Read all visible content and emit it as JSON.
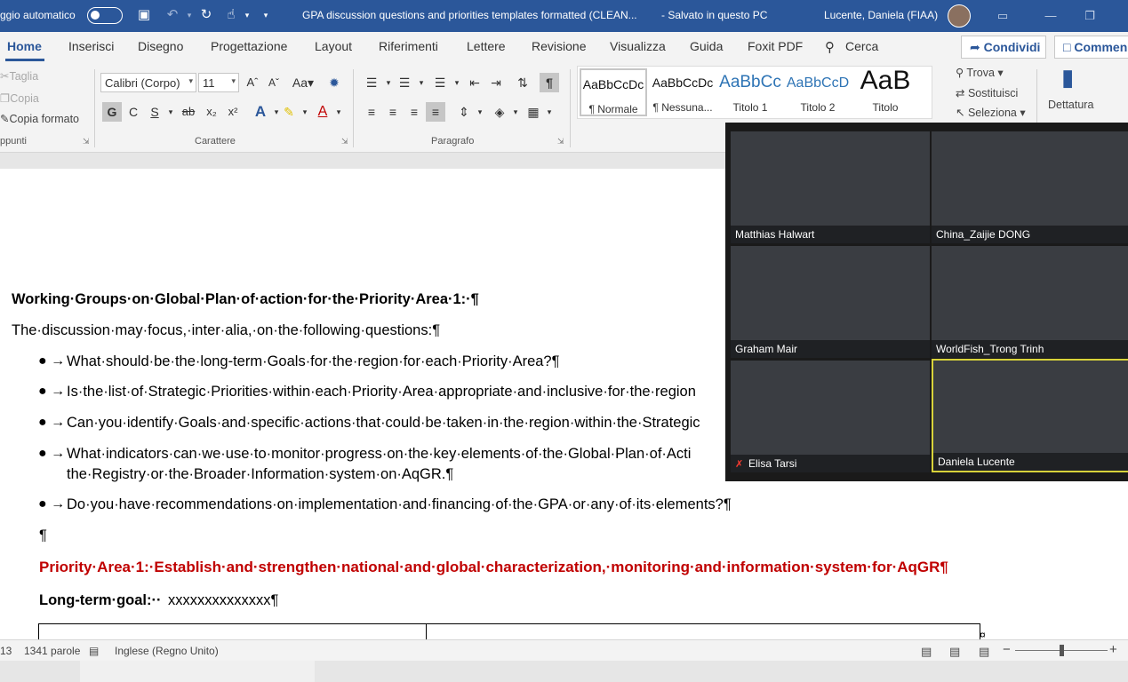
{
  "titlebar": {
    "autosave_label": "ggio automatico",
    "document_title": "GPA discussion questions and priorities templates formatted (CLEAN...",
    "save_status": "-  Salvato in questo PC",
    "user_name": "Lucente, Daniela (FIAA)"
  },
  "tabs": [
    {
      "label": "Home"
    },
    {
      "label": "Inserisci"
    },
    {
      "label": "Disegno"
    },
    {
      "label": "Progettazione"
    },
    {
      "label": "Layout"
    },
    {
      "label": "Riferimenti"
    },
    {
      "label": "Lettere"
    },
    {
      "label": "Revisione"
    },
    {
      "label": "Visualizza"
    },
    {
      "label": "Guida"
    },
    {
      "label": "Foxit PDF"
    },
    {
      "label": "Cerca"
    }
  ],
  "share_label": "Condividi",
  "comments_label": "Commen",
  "ribbon": {
    "clipboard": {
      "cut": "Taglia",
      "copy": "Copia",
      "format_painter": "Copia formato",
      "group": "ppunti"
    },
    "font": {
      "family": "Calibri (Corpo)",
      "size": "11",
      "change_case": "Aa",
      "bold": "G",
      "italic": "C",
      "underline": "S",
      "strike": "ab",
      "subscript": "x₂",
      "superscript": "x²",
      "text_effects": "A",
      "font_color": "A",
      "group": "Carattere"
    },
    "paragraph": {
      "pilcrow": "¶",
      "group": "Paragrafo"
    },
    "styles": [
      {
        "preview": "AaBbCcDc",
        "name": "¶ Normale"
      },
      {
        "preview": "AaBbCcDc",
        "name": "¶ Nessuna..."
      },
      {
        "preview": "AaBbCc",
        "name": "Titolo 1"
      },
      {
        "preview": "AaBbCcD",
        "name": "Titolo 2"
      },
      {
        "preview": "AaB",
        "name": "Titolo"
      }
    ],
    "editing": {
      "find": "Trova",
      "replace": "Sostituisci",
      "select": "Seleziona"
    },
    "dictate": "Dettatura"
  },
  "document": {
    "heading": "Working·Groups·on·Global·Plan·of·action·for·the·Priority·Area·1:·¶",
    "intro": "The·discussion·may·focus,·inter·alia,·on·the·following·questions:¶",
    "questions": [
      "What·should·be·the·long-term·Goals·for·the·region·for·each·Priority·Area?¶",
      "Is·the·list·of·Strategic·Priorities·within·each·Priority·Area·appropriate·and·inclusive·for·the·region",
      "Can·you·identify·Goals·and·specific·actions·that·could·be·taken·in·the·region·within·the·Strategic",
      "What·indicators·can·we·use·to·monitor·progress·on·the·key·elements·of·the·Global·Plan·of·Acti",
      "Do·you·have·recommendations·on·implementation·and·financing·of·the·GPA·or·any·of·its·elements?¶"
    ],
    "question4_continued": "the·Registry·or·the·Broader·Information·system·on·AqGR.¶",
    "empty_paragraph": "¶",
    "priority_heading": "Priority·Area·1:·Establish·and·strengthen·national·and·global·characterization,·monitoring·and·information·system·for·AqGR¶",
    "long_term_goal_label": "Long-term·goal:··",
    "long_term_goal_value": "xxxxxxxxxxxxxx¶"
  },
  "video": {
    "participants": [
      {
        "name": "Matthias Halwart",
        "muted": false,
        "active": false
      },
      {
        "name": "China_Zaijie DONG",
        "muted": false,
        "active": false
      },
      {
        "name": "Graham Mair",
        "muted": false,
        "active": false
      },
      {
        "name": "WorldFish_Trong Trinh",
        "muted": false,
        "active": false
      },
      {
        "name": "Elisa Tarsi",
        "muted": true,
        "active": false
      },
      {
        "name": "Daniela Lucente",
        "muted": false,
        "active": true
      }
    ]
  },
  "statusbar": {
    "page": "13",
    "word_count": "1341 parole",
    "language": "Inglese (Regno Unito)"
  },
  "colors": {
    "word_blue": "#2b579a",
    "heading_red": "#c00000",
    "active_speaker": "#d8d33a"
  }
}
